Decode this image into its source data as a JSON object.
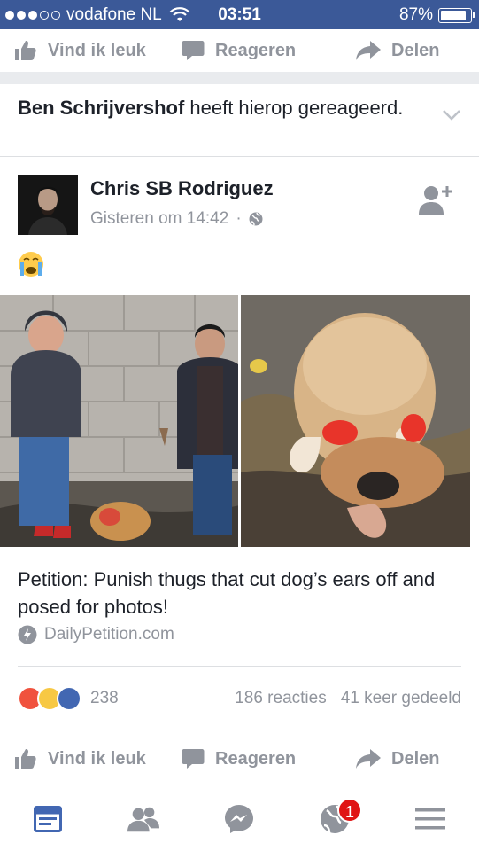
{
  "status_bar": {
    "carrier": "vodafone NL",
    "time": "03:51",
    "battery": "87%",
    "battery_level": 0.87
  },
  "top_actions": {
    "like": "Vind ik leuk",
    "comment": "Reageren",
    "share": "Delen"
  },
  "notice": {
    "actor": "Ben Schrijvershof",
    "text": " heeft hierop gereageerd."
  },
  "post": {
    "author": "Chris SB Rodriguez",
    "timestamp": "Gisteren om 14:42",
    "separator": "·",
    "emoji_icon": "crying-face-emoji",
    "link_title": "Petition: Punish thugs that cut dog’s ears off and posed for photos!",
    "link_source": "DailyPetition.com"
  },
  "reactions": {
    "count": "238",
    "comments": "186 reacties",
    "shares": "41 keer gedeeld"
  },
  "bottom_actions": {
    "like": "Vind ik leuk",
    "comment": "Reageren",
    "share": "Delen"
  },
  "tab_bar": {
    "items": [
      "news-feed",
      "friends",
      "messenger",
      "notifications",
      "menu"
    ],
    "notification_count": "1"
  },
  "colors": {
    "brand": "#3b5998",
    "accent": "#4267b2",
    "muted": "#90949c",
    "badge": "#e01414"
  }
}
